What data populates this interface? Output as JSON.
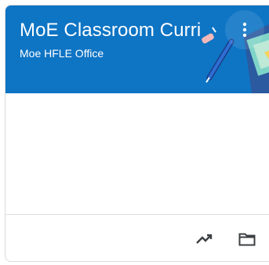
{
  "card": {
    "title": "MoE Classroom Curri",
    "subtitle": "Moe HFLE Office",
    "banner_color": "#0e74c4"
  },
  "icons": {
    "menu": "more-vert-icon",
    "trending": "trending-up-icon",
    "folder": "folder-icon"
  }
}
